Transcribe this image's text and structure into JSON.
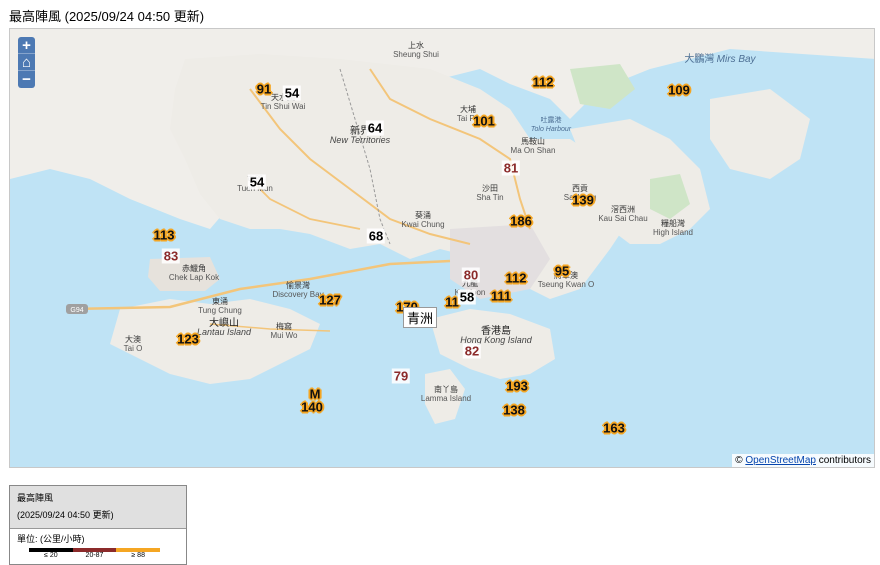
{
  "title": "最高陣風 (2025/09/24 04:50 更新)",
  "zoom": {
    "in": "+",
    "home": "⌂",
    "out": "−"
  },
  "attribution": {
    "prefix": "©",
    "link": "OpenStreetMap",
    "suffix": "contributors"
  },
  "road_label": "G94",
  "places": [
    {
      "zh": "上水",
      "en": "Sheung Shui"
    },
    {
      "zh": "大鵬灣",
      "en": "Mirs Bay"
    },
    {
      "zh": "天水圍",
      "en": "Tin Shui Wai"
    },
    {
      "zh": "大埔",
      "en": "Tai Po"
    },
    {
      "zh": "吐露港",
      "en": "Tolo Harbour"
    },
    {
      "zh": "新界",
      "en": "New Territories"
    },
    {
      "zh": "馬鞍山",
      "en": "Ma On Shan"
    },
    {
      "zh": "屯門",
      "en": "Tuen Mun"
    },
    {
      "zh": "沙田",
      "en": "Sha Tin"
    },
    {
      "zh": "西貢",
      "en": "Sai Kung"
    },
    {
      "zh": "滘西洲",
      "en": "Kau Sai Chau"
    },
    {
      "zh": "糧船灣",
      "en": "High Island"
    },
    {
      "zh": "葵涌",
      "en": "Kwai Chung"
    },
    {
      "zh": "赤鱲角",
      "en": "Chek Lap Kok"
    },
    {
      "zh": "愉景灣",
      "en": "Discovery Bay"
    },
    {
      "zh": "東涌",
      "en": "Tung Chung"
    },
    {
      "zh": "九龍",
      "en": "Kowloon"
    },
    {
      "zh": "將軍澳",
      "en": "Tseung Kwan O"
    },
    {
      "zh": "大嶼山",
      "en": "Lantau Island"
    },
    {
      "zh": "梅窩",
      "en": "Mui Wo"
    },
    {
      "zh": "香港島",
      "en": "Hong Kong Island"
    },
    {
      "zh": "大澳",
      "en": "Tai O"
    },
    {
      "zh": "南丫島",
      "en": "Lamma Island"
    }
  ],
  "winds": [
    {
      "value": "91",
      "level": "hi"
    },
    {
      "value": "54",
      "level": "lo"
    },
    {
      "value": "112",
      "level": "hi"
    },
    {
      "value": "109",
      "level": "hi"
    },
    {
      "value": "64",
      "level": "lo"
    },
    {
      "value": "101",
      "level": "hi"
    },
    {
      "value": "81",
      "level": "mid"
    },
    {
      "value": "54",
      "level": "lo"
    },
    {
      "value": "139",
      "level": "hi"
    },
    {
      "value": "186",
      "level": "hi"
    },
    {
      "value": "113",
      "level": "hi"
    },
    {
      "value": "68",
      "level": "lo"
    },
    {
      "value": "83",
      "level": "mid"
    },
    {
      "value": "80",
      "level": "mid"
    },
    {
      "value": "112",
      "level": "hi"
    },
    {
      "value": "95",
      "level": "hi"
    },
    {
      "value": "111",
      "level": "hi"
    },
    {
      "value": "127",
      "level": "hi"
    },
    {
      "value": "170",
      "level": "hi"
    },
    {
      "value": "11",
      "level": "hi"
    },
    {
      "value": "58",
      "level": "lo"
    },
    {
      "value": "123",
      "level": "hi"
    },
    {
      "value": "82",
      "level": "mid"
    },
    {
      "value": "79",
      "level": "mid"
    },
    {
      "value": "193",
      "level": "hi"
    },
    {
      "value": "M",
      "level": "hi"
    },
    {
      "value": "140",
      "level": "hi"
    },
    {
      "value": "138",
      "level": "hi"
    },
    {
      "value": "163",
      "level": "hi"
    }
  ],
  "tooltip": "青洲",
  "legend": {
    "title": "最高陣風",
    "time": "(2025/09/24 04:50 更新)",
    "unit": "單位: (公里/小時)",
    "ranges": [
      {
        "label": "≤ 20",
        "color": "#000000"
      },
      {
        "label": "20-87",
        "color": "#8b2a2a"
      },
      {
        "label": "≥ 88",
        "color": "#f5a623"
      }
    ]
  }
}
